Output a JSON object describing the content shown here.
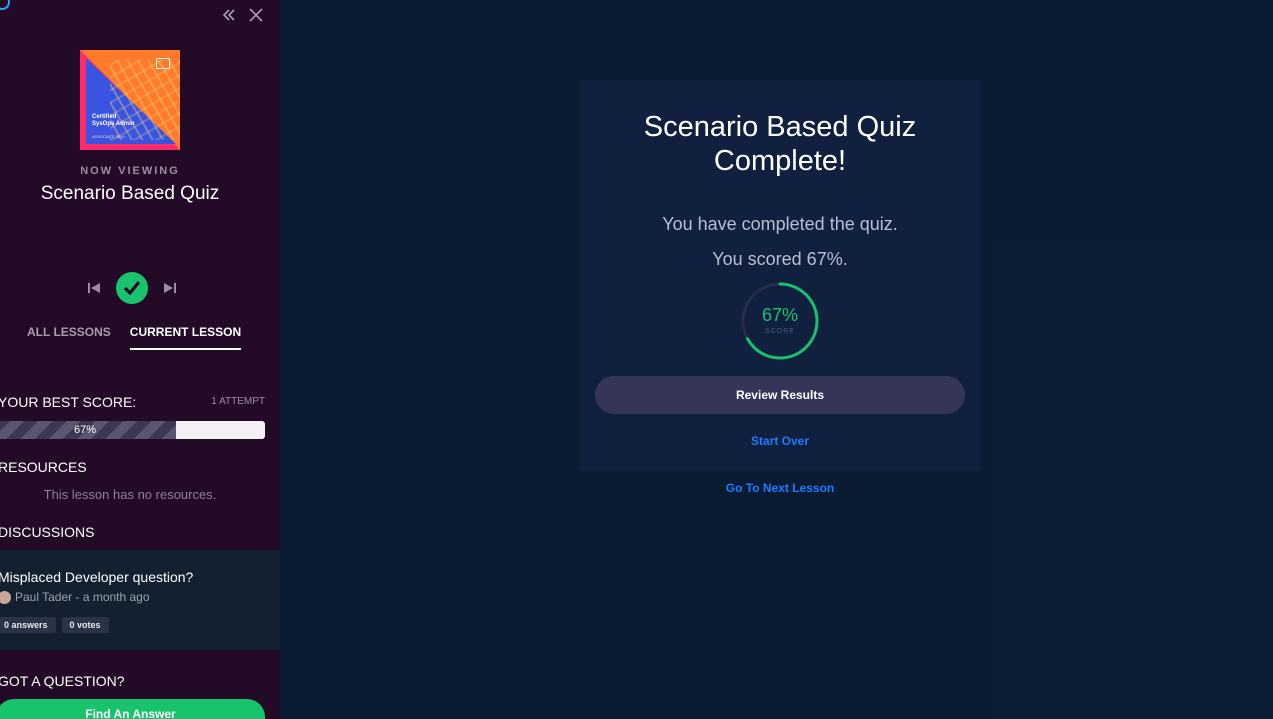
{
  "sidebar": {
    "cover": {
      "title_line1": "Certified",
      "title_line2": "SysOps Admin",
      "subtitle": "ASSOCIATE 2019"
    },
    "now_viewing": "NOW VIEWING",
    "lesson_title": "Scenario Based Quiz",
    "tabs": [
      {
        "label": "ALL LESSONS",
        "active": false
      },
      {
        "label": "CURRENT LESSON",
        "active": true
      }
    ],
    "best_score": {
      "label": "YOUR BEST SCORE:",
      "attempts": "1 ATTEMPT",
      "value_text": "67%",
      "fraction": 0.67
    },
    "resources": {
      "label": "RESOURCES",
      "empty_text": "This lesson has no resources."
    },
    "discussions": {
      "label": "DISCUSSIONS",
      "items": [
        {
          "title": "Misplaced Developer question?",
          "meta": "Paul Tader - a month ago",
          "answers": "0 answers",
          "votes": "0 votes"
        }
      ]
    },
    "question": {
      "label": "GOT A QUESTION?",
      "button": "Find An Answer"
    }
  },
  "quiz": {
    "title": "Scenario Based Quiz Complete!",
    "completed_text": "You have completed the quiz.",
    "scored_text": "You scored 67%.",
    "gauge": {
      "percent_text": "67%",
      "label": "SCORE",
      "fraction": 0.67
    },
    "review_button": "Review Results",
    "start_over": "Start Over",
    "next_lesson": "Go To Next Lesson"
  },
  "colors": {
    "accent_green": "#17c46b",
    "link_blue": "#1b7dff",
    "sidebar_bg": "#230a27",
    "main_bg": "#0b1b33"
  }
}
